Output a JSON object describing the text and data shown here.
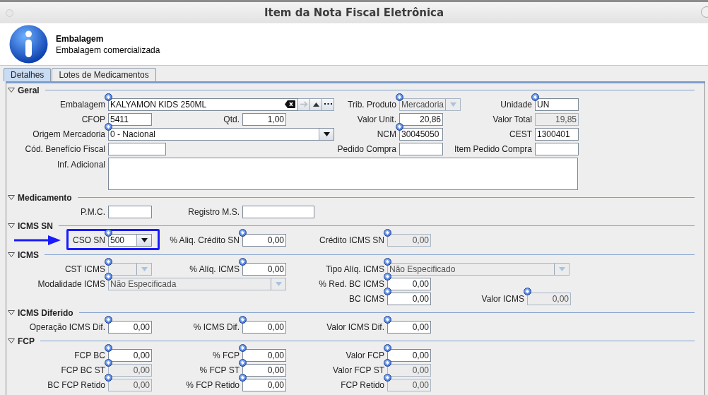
{
  "window": {
    "title": "Item da Nota Fiscal Eletrônica"
  },
  "header": {
    "title": "Embalagem",
    "subtitle": "Embalagem comercializada"
  },
  "tabs": [
    {
      "label": "Detalhes",
      "selected": true
    },
    {
      "label": "Lotes de Medicamentos",
      "selected": false
    }
  ],
  "sections": [
    {
      "title": "Geral",
      "expanded": true,
      "rows": [
        {
          "fields": [
            {
              "label": "Embalagem",
              "kind": "lookup",
              "value": "KALYAMON KIDS 250ML",
              "required": true,
              "disabled": false
            },
            {
              "label": "Trib. Produto",
              "kind": "combo",
              "value": "Mercadoria",
              "required": true,
              "disabled": true
            },
            {
              "label": "Unidade",
              "kind": "text",
              "value": "UN",
              "required": true,
              "disabled": false
            }
          ]
        },
        {
          "fields": [
            {
              "label": "CFOP",
              "kind": "text",
              "value": "5411",
              "required": false,
              "disabled": false
            },
            {
              "label": "Qtd.",
              "kind": "number",
              "value": "1,00",
              "required": false,
              "disabled": false
            },
            {
              "label": "Valor Unit.",
              "kind": "number",
              "value": "20,86",
              "required": false,
              "disabled": false
            },
            {
              "label": "Valor Total",
              "kind": "number",
              "value": "19,85",
              "required": false,
              "disabled": true
            }
          ]
        },
        {
          "fields": [
            {
              "label": "Origem Mercadoria",
              "kind": "combo",
              "value": "0 - Nacional",
              "required": true,
              "disabled": false
            },
            {
              "label": "NCM",
              "kind": "text",
              "value": "30045050",
              "required": true,
              "disabled": false
            },
            {
              "label": "CEST",
              "kind": "text",
              "value": "1300401",
              "required": false,
              "disabled": false
            }
          ]
        },
        {
          "fields": [
            {
              "label": "Cód. Benefício Fiscal",
              "kind": "text",
              "required": false,
              "disabled": false
            },
            {
              "label": "Pedido Compra",
              "kind": "text",
              "required": false,
              "disabled": false
            },
            {
              "label": "Item Pedido Compra",
              "kind": "text",
              "required": false,
              "disabled": false
            }
          ]
        },
        {
          "fields": [
            {
              "label": "Inf. Adicional",
              "kind": "textarea",
              "required": false,
              "disabled": false
            }
          ]
        }
      ]
    },
    {
      "title": "Medicamento",
      "expanded": true,
      "rows": [
        {
          "fields": [
            {
              "label": "P.M.C.",
              "kind": "text",
              "required": false,
              "disabled": false
            },
            {
              "label": "Registro M.S.",
              "kind": "text",
              "required": false,
              "disabled": false
            }
          ]
        }
      ]
    },
    {
      "title": "ICMS SN",
      "expanded": true,
      "rows": [
        {
          "fields": [
            {
              "label": "CSO SN",
              "kind": "combo",
              "value": "500",
              "required": true,
              "disabled": false,
              "highlighted": true
            },
            {
              "label": "% Aliq. Crédito SN",
              "kind": "number",
              "value": "0,00",
              "required": true,
              "disabled": false
            },
            {
              "label": "Crédito ICMS SN",
              "kind": "number",
              "value": "0,00",
              "required": true,
              "disabled": true
            }
          ]
        }
      ]
    },
    {
      "title": "ICMS",
      "expanded": true,
      "rows": [
        {
          "fields": [
            {
              "label": "CST ICMS",
              "kind": "combo",
              "required": true,
              "disabled": true
            },
            {
              "label": "% Alíq. ICMS",
              "kind": "number",
              "value": "0,00",
              "required": true,
              "disabled": false
            },
            {
              "label": "Tipo Alíq. ICMS",
              "kind": "combo",
              "value": "Não Especificado",
              "required": true,
              "disabled": true
            }
          ]
        },
        {
          "fields": [
            {
              "label": "Modalidade ICMS",
              "kind": "combo",
              "value": "Não Especificada",
              "required": true,
              "disabled": true
            },
            {
              "label": "% Red. BC ICMS",
              "kind": "number",
              "value": "0,00",
              "required": true,
              "disabled": false
            }
          ]
        },
        {
          "fields": [
            {
              "label": "BC ICMS",
              "kind": "number",
              "value": "0,00",
              "required": true,
              "disabled": false
            },
            {
              "label": "Valor ICMS",
              "kind": "number",
              "value": "0,00",
              "required": true,
              "disabled": true
            }
          ]
        }
      ]
    },
    {
      "title": "ICMS Diferido",
      "expanded": true,
      "rows": [
        {
          "fields": [
            {
              "label": "Operação ICMS Dif.",
              "kind": "number",
              "value": "0,00",
              "required": true,
              "disabled": false
            },
            {
              "label": "% ICMS Dif.",
              "kind": "number",
              "value": "0,00",
              "required": true,
              "disabled": false
            },
            {
              "label": "Valor ICMS Dif.",
              "kind": "number",
              "value": "0,00",
              "required": true,
              "disabled": false
            }
          ]
        }
      ]
    },
    {
      "title": "FCP",
      "expanded": true,
      "rows": [
        {
          "fields": [
            {
              "label": "FCP BC",
              "kind": "number",
              "value": "0,00",
              "required": true,
              "disabled": false
            },
            {
              "label": "% FCP",
              "kind": "number",
              "value": "0,00",
              "required": true,
              "disabled": false
            },
            {
              "label": "Valor FCP",
              "kind": "number",
              "value": "0,00",
              "required": true,
              "disabled": false
            }
          ]
        },
        {
          "fields": [
            {
              "label": "FCP BC ST",
              "kind": "number",
              "value": "0,00",
              "required": true,
              "disabled": true
            },
            {
              "label": "% FCP ST",
              "kind": "number",
              "value": "0,00",
              "required": true,
              "disabled": false
            },
            {
              "label": "Valor FCP ST",
              "kind": "number",
              "value": "0,00",
              "required": true,
              "disabled": true
            }
          ]
        },
        {
          "fields": [
            {
              "label": "BC FCP Retido",
              "kind": "number",
              "value": "0,00",
              "required": true,
              "disabled": true
            },
            {
              "label": "% FCP Retido",
              "kind": "number",
              "value": "0,00",
              "required": true,
              "disabled": false
            },
            {
              "label": "FCP Retido",
              "kind": "number",
              "value": "0,00",
              "required": true,
              "disabled": true
            }
          ]
        }
      ]
    }
  ]
}
